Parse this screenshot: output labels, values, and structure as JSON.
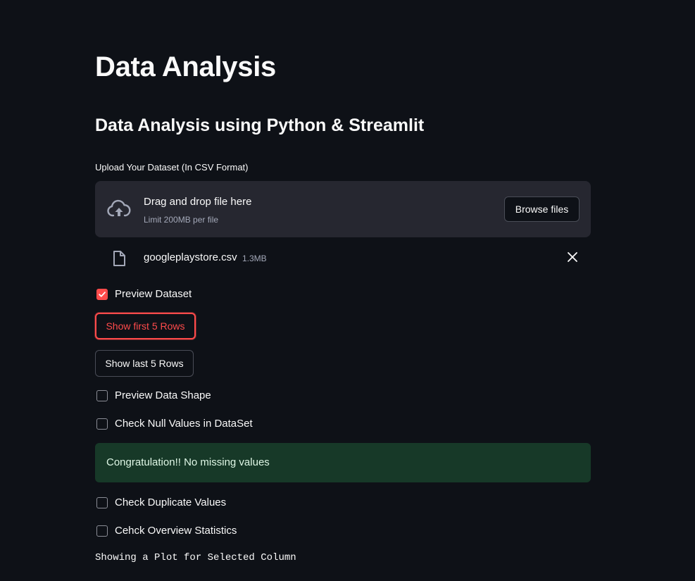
{
  "page": {
    "title": "Data Analysis",
    "subtitle": "Data Analysis using Python & Streamlit"
  },
  "uploader": {
    "label": "Upload Your Dataset (In CSV Format)",
    "drag_text": "Drag and drop file here",
    "limit_text": "Limit 200MB per file",
    "browse_label": "Browse files",
    "icon": "cloud-upload-icon"
  },
  "uploaded_file": {
    "name": "googleplaystore.csv",
    "size": "1.3MB",
    "icon": "file-icon",
    "remove_icon": "close-icon"
  },
  "controls": {
    "preview_dataset": {
      "label": "Preview Dataset",
      "checked": true
    },
    "show_first_rows": {
      "label": "Show first 5 Rows",
      "active": true
    },
    "show_last_rows": {
      "label": "Show last 5 Rows"
    },
    "preview_shape": {
      "label": "Preview Data Shape",
      "checked": false
    },
    "check_null": {
      "label": "Check Null Values in DataSet",
      "checked": false
    },
    "check_duplicates": {
      "label": "Check Duplicate Values",
      "checked": false
    },
    "overview_stats": {
      "label": "Cehck Overview Statistics",
      "checked": false
    }
  },
  "messages": {
    "success": "Congratulation!! No missing values",
    "plot_heading": "Showing a Plot for Selected Column"
  },
  "colors": {
    "background": "#0e1117",
    "accent": "#ff4b4b",
    "dropzone": "#262730",
    "success_bg": "#173928"
  }
}
